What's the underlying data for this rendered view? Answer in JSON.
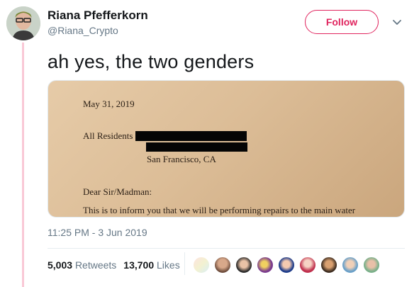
{
  "author": {
    "name": "Riana Pfefferkorn",
    "handle": "@Riana_Crypto"
  },
  "follow_label": "Follow",
  "tweet": {
    "text": "ah yes, the two genders",
    "timestamp": "11:25 PM - 3 Jun 2019"
  },
  "photo": {
    "date_line": "May 31, 2019",
    "residents_line": "All Residents",
    "city_line": "San Francisco, CA",
    "salutation": "Dear Sir/Madman:",
    "body_line": "This is to inform you that we will be performing repairs to the main water"
  },
  "stats": {
    "retweets_count": "5,003",
    "retweets_label": "Retweets",
    "likes_count": "13,700",
    "likes_label": "Likes"
  },
  "colors": {
    "accent": "#e0245e",
    "thread_line": "#f9c8d6",
    "muted_text": "#657786"
  },
  "icons": {
    "caret": "chevron-down-icon"
  }
}
